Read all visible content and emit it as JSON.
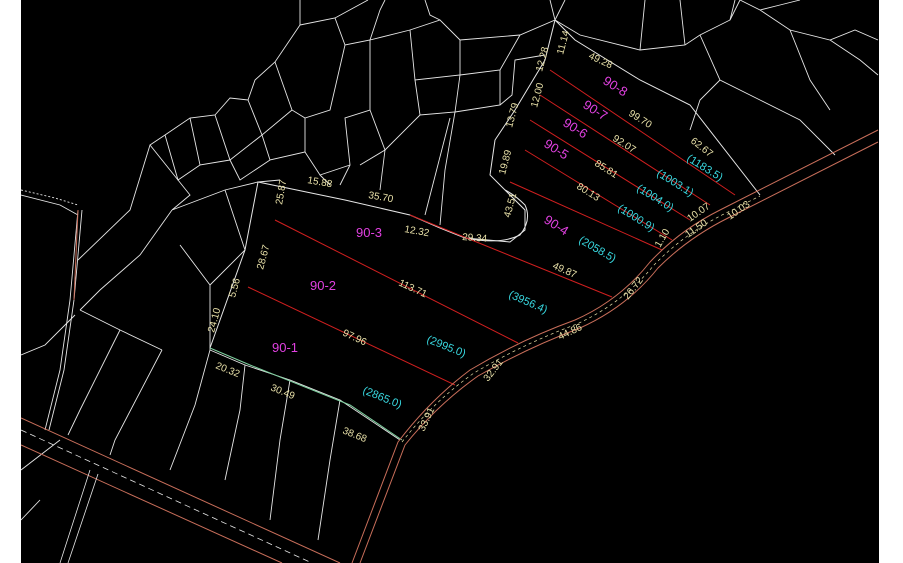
{
  "colors": {
    "background": "#000000",
    "page_margin": "#ffffff",
    "parcel_line": "#e6e6e6",
    "subdivision_line": "#d01f1f",
    "road_line": "#c86e5a",
    "dimension_text": "#e8e0a8",
    "lot_label": "#e040e0",
    "area_label": "#38d8e0"
  },
  "lots": [
    {
      "id": "lot-90-1",
      "label": "90-1"
    },
    {
      "id": "lot-90-2",
      "label": "90-2"
    },
    {
      "id": "lot-90-3",
      "label": "90-3"
    },
    {
      "id": "lot-90-4",
      "label": "90-4"
    },
    {
      "id": "lot-90-5",
      "label": "90-5"
    },
    {
      "id": "lot-90-6",
      "label": "90-6"
    },
    {
      "id": "lot-90-7",
      "label": "90-7"
    },
    {
      "id": "lot-90-8",
      "label": "90-8"
    }
  ],
  "areas": [
    {
      "id": "area-2865",
      "label": "(2865.0)"
    },
    {
      "id": "area-2995",
      "label": "(2995.0)"
    },
    {
      "id": "area-3956",
      "label": "(3956.4)"
    },
    {
      "id": "area-2058",
      "label": "(2058.5)"
    },
    {
      "id": "area-1000",
      "label": "(1000.9)"
    },
    {
      "id": "area-1004",
      "label": "(1004.0)"
    },
    {
      "id": "area-1003",
      "label": "(1003.1)"
    },
    {
      "id": "area-1183",
      "label": "(1183.5)"
    }
  ],
  "dimensions": [
    "20.32",
    "30.49",
    "38.68",
    "33.91",
    "32.91",
    "44.86",
    "26.72",
    "24.10",
    "5.56",
    "28.67",
    "25.87",
    "15.88",
    "35.70",
    "12.32",
    "29.34",
    "97.96",
    "113.71",
    "49.87",
    "43.51",
    "19.89",
    "13.79",
    "12.00",
    "12.28",
    "11.14",
    "49.28",
    "99.70",
    "92.07",
    "85.81",
    "80.13",
    "62.67",
    "10.07",
    "10.03",
    "11.50",
    "1.10"
  ]
}
